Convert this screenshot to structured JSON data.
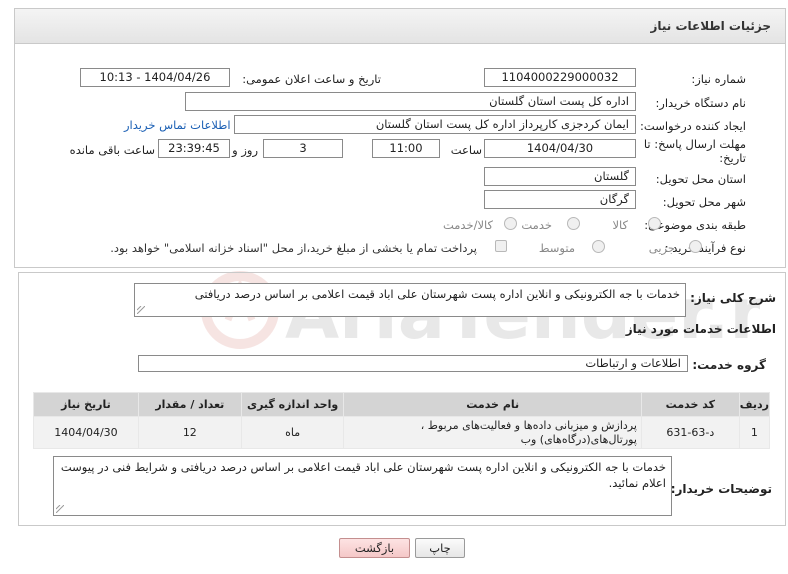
{
  "header": {
    "title": "جزئیات اطلاعات نیاز"
  },
  "form": {
    "need_number_label": "شماره نیاز:",
    "need_number": "1104000229000032",
    "announce_label": "تاریخ و ساعت اعلان عمومی:",
    "announce_value": "1404/04/26 - 10:13",
    "buyer_org_label": "نام دستگاه خریدار:",
    "buyer_org": "اداره کل پست استان گلستان",
    "creator_label": "ایجاد کننده درخواست:",
    "creator": "ایمان کردجزی کارپرداز اداره کل پست استان گلستان",
    "contact_link": "اطلاعات تماس خریدار",
    "deadline_label_1": "مهلت ارسال پاسخ: تا",
    "deadline_label_2": "تاریخ:",
    "deadline_date": "1404/04/30",
    "time_label": "ساعت",
    "deadline_time": "11:00",
    "days_value": "3",
    "days_label": "روز و",
    "remaining_time": "23:39:45",
    "remaining_label": "ساعت باقی مانده",
    "province_label": "استان محل تحویل:",
    "province": "گلستان",
    "city_label": "شهر محل تحویل:",
    "city": "گرگان",
    "category_label": "طبقه بندی موضوعی:",
    "category_options": [
      "کالا",
      "خدمت",
      "کالا/خدمت"
    ],
    "purchase_type_label": "نوع فرآیند خرید :",
    "purchase_type_options": [
      "جزیی",
      "متوسط"
    ],
    "payment_note": "پرداخت تمام یا بخشی از مبلغ خرید،از محل \"اسناد خزانه اسلامی\" خواهد بود."
  },
  "details": {
    "summary_label": "شرح کلی نیاز:",
    "summary": "خدمات با جه الکترونیکی و انلاین اداره پست شهرستان علی اباد قیمت اعلامی بر اساس درصد دریافتی",
    "services_heading": "اطلاعات خدمات مورد نیاز",
    "service_group_label": "گروه خدمت:",
    "service_group": "اطلاعات و ارتباطات",
    "table": {
      "headers": [
        "ردیف",
        "کد خدمت",
        "نام خدمت",
        "واحد اندازه گیری",
        "تعداد / مقدار",
        "تاریخ نیاز"
      ],
      "rows": [
        [
          "1",
          "د-63-631",
          "پردازش و میزبانی داده‌ها و فعالیت‌های مربوط ، پورتال‌های(درگاه‌های) وب",
          "ماه",
          "12",
          "1404/04/30"
        ]
      ]
    },
    "buyer_notes_label": "توضیحات خریدار:",
    "buyer_notes": "خدمات با جه الکترونیکی و انلاین اداره پست شهرستان علی اباد قیمت اعلامی بر اساس درصد دریافتی  و شرایط فنی در پیوست اعلام نمائید."
  },
  "buttons": {
    "print": "چاپ",
    "back": "بازگشت"
  },
  "watermark": {
    "text": "AriaTender.net"
  }
}
